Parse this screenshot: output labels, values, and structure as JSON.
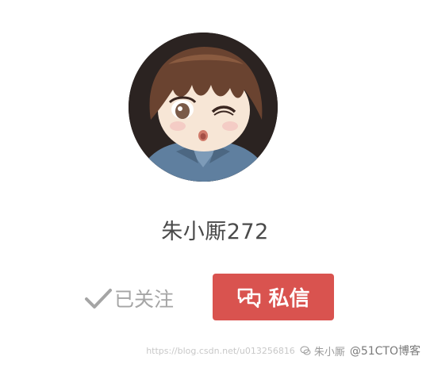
{
  "profile": {
    "username": "朱小厮272",
    "avatar_alt": "avatar"
  },
  "actions": {
    "follow_status_label": "已关注",
    "message_button_label": "私信"
  },
  "watermark": {
    "faded_url": "https://blog.csdn.net/u013256816",
    "author": "朱小厮",
    "brand": "@51CTO博客"
  },
  "icons": {
    "follow": "checkmark-icon",
    "message": "chat-bubbles-icon",
    "watermark": "wechat-icon"
  },
  "colors": {
    "message_button": "#d9534f",
    "follow_text": "#a5a5a5",
    "username_text": "#4a4a4a"
  }
}
